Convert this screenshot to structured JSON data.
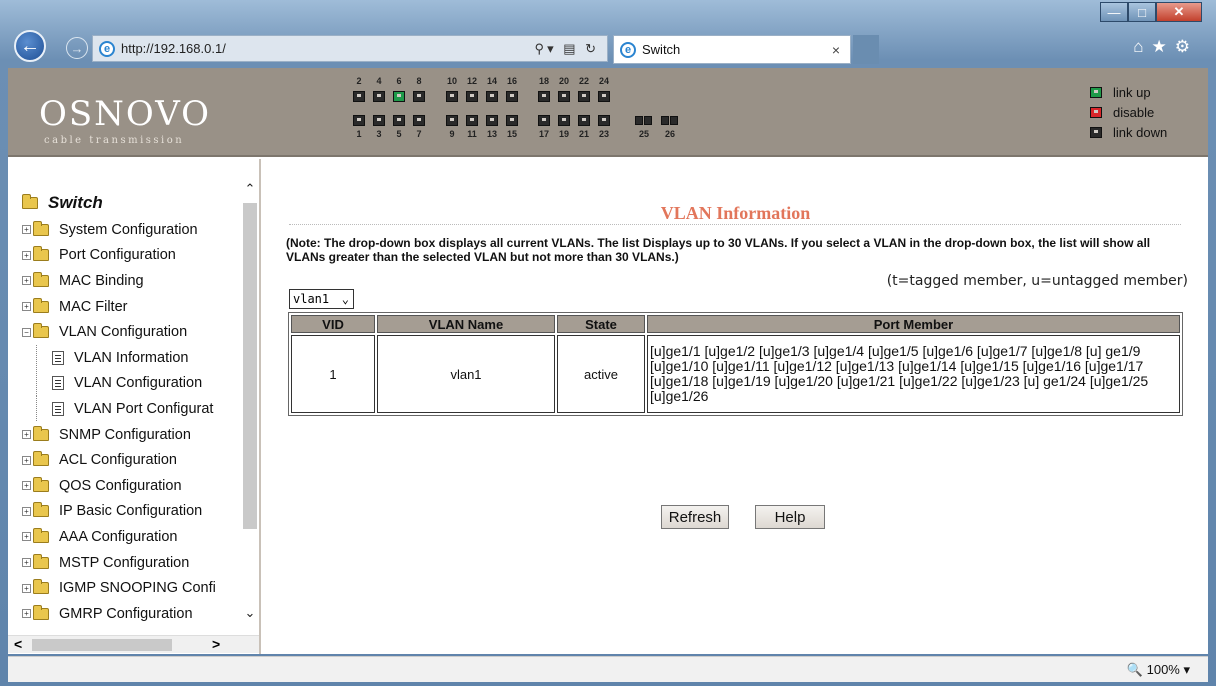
{
  "browser": {
    "address": "http://192.168.0.1/",
    "tab_title": "Switch",
    "tab_close": "×",
    "zoom": "100%"
  },
  "header": {
    "logo": "OSNOVO",
    "logo_sub": "cable transmission",
    "ports_top": [
      "2",
      "4",
      "6",
      "8",
      "10",
      "12",
      "14",
      "16",
      "18",
      "20",
      "22",
      "24"
    ],
    "ports_bottom": [
      "1",
      "3",
      "5",
      "7",
      "9",
      "11",
      "13",
      "15",
      "17",
      "19",
      "21",
      "23",
      "25",
      "26"
    ],
    "port_up": "6",
    "legend": [
      {
        "label": "link up",
        "color": "#1e9a49"
      },
      {
        "label": "disable",
        "color": "#d9262a"
      },
      {
        "label": "link down",
        "color": "#2a2a2a"
      }
    ]
  },
  "sidebar": {
    "root": "Switch",
    "items": [
      "System Configuration",
      "Port Configuration",
      "MAC Binding",
      "MAC Filter",
      "VLAN Configuration"
    ],
    "vlan_children": [
      "VLAN Information",
      "VLAN Configuration",
      "VLAN Port Configurat"
    ],
    "items_after": [
      "SNMP Configuration",
      "ACL Configuration",
      "QOS Configuration",
      "IP Basic Configuration",
      "AAA Configuration",
      "MSTP Configuration",
      "IGMP SNOOPING Confi",
      "GMRP Configuration"
    ]
  },
  "main": {
    "title": "VLAN Information",
    "note": "(Note: The drop-down box displays all current VLANs. The list Displays up to 30 VLANs. If you select a VLAN in the drop-down box, the list will show all VLANs greater than the selected VLAN but not more than 30 VLANs.)",
    "tag_note": "(t=tagged member, u=untagged member)",
    "select_value": "vlan1",
    "table": {
      "headers": [
        "VID",
        "VLAN Name",
        "State",
        "Port Member"
      ],
      "rows": [
        {
          "vid": "1",
          "name": "vlan1",
          "state": "active",
          "members": "[u]ge1/1 [u]ge1/2 [u]ge1/3 [u]ge1/4 [u]ge1/5 [u]ge1/6 [u]ge1/7 [u]ge1/8 [u] ge1/9 [u]ge1/10 [u]ge1/11 [u]ge1/12 [u]ge1/13 [u]ge1/14 [u]ge1/15 [u]ge1/16 [u]ge1/17 [u]ge1/18 [u]ge1/19 [u]ge1/20 [u]ge1/21 [u]ge1/22 [u]ge1/23 [u] ge1/24 [u]ge1/25 [u]ge1/26"
        }
      ]
    },
    "refresh_label": "Refresh",
    "help_label": "Help"
  }
}
